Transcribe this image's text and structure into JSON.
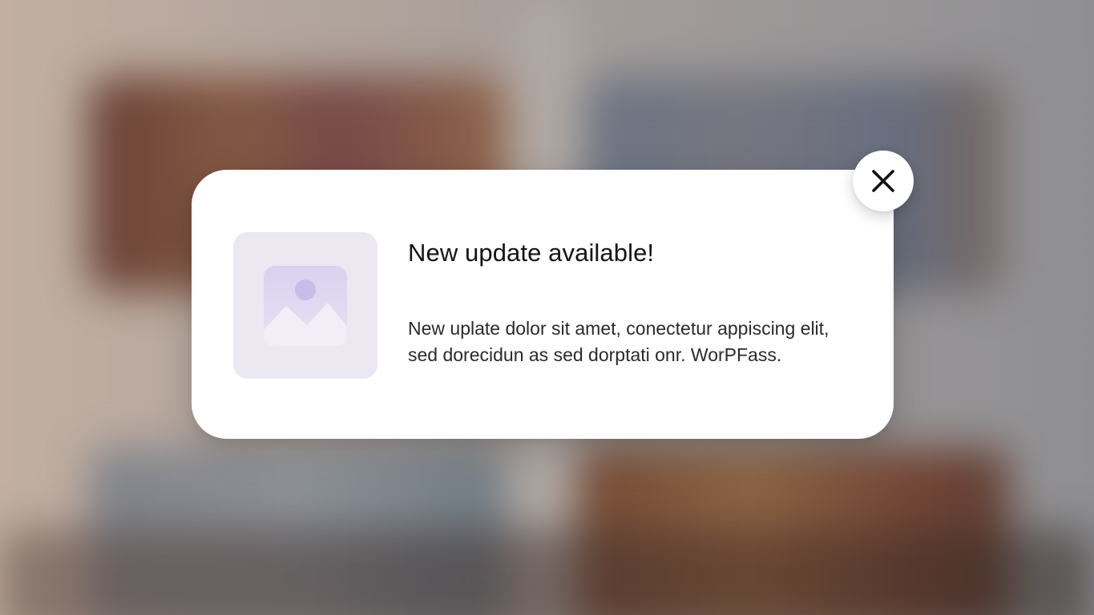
{
  "notification": {
    "title": "New update available!",
    "message_line1": "New uplate dolor sit amet, conectetur appiscing elit,",
    "message_line2": "sed dorecidun as sed dorptati onr. WorPFass.",
    "thumbnail_icon": "image-placeholder-icon",
    "close_icon": "close-icon"
  },
  "colors": {
    "card_background": "#ffffff",
    "thumbnail_background": "#ebe8f2",
    "thumbnail_accent": "#c9bfe6",
    "title_text": "#141418",
    "body_text": "#2a2a2e"
  }
}
